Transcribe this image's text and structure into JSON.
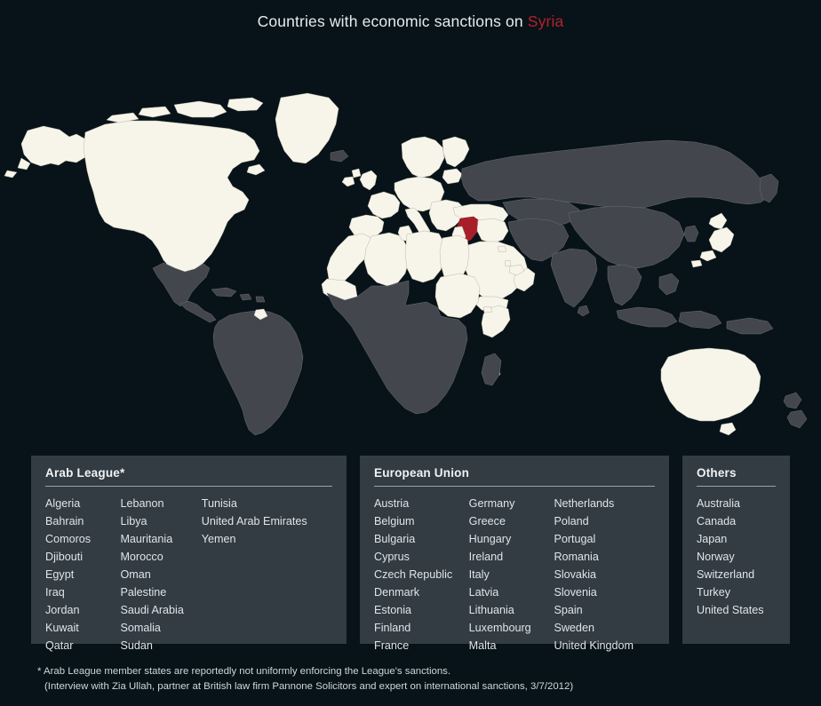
{
  "title": {
    "prefix": "Countries with economic sanctions on ",
    "subject": "Syria"
  },
  "colors": {
    "background": "#071318",
    "panel_background": "#333b43",
    "highlight_country": "#f7f5e9",
    "unhighlighted_country": "#43464c",
    "subject_country": "#a81f2a",
    "title_accent": "#b5202c",
    "text": "#dfe5e8"
  },
  "map": {
    "name": "world-map",
    "legend": {
      "highlighted_meaning": "Country imposing economic sanctions on Syria",
      "subject_meaning": "Syria"
    }
  },
  "panels": [
    {
      "id": "arab-league",
      "heading": "Arab League*",
      "columns": [
        [
          "Algeria",
          "Bahrain",
          "Comoros",
          "Djibouti",
          "Egypt",
          "Iraq",
          "Jordan",
          "Kuwait",
          "Qatar"
        ],
        [
          "Lebanon",
          "Libya",
          "Mauritania",
          "Morocco",
          "Oman",
          "Palestine",
          "Saudi Arabia",
          "Somalia",
          "Sudan"
        ],
        [
          "Tunisia",
          "United Arab Emirates",
          "Yemen"
        ]
      ]
    },
    {
      "id": "european-union",
      "heading": "European Union",
      "columns": [
        [
          "Austria",
          "Belgium",
          "Bulgaria",
          "Cyprus",
          "Czech Republic",
          "Denmark",
          "Estonia",
          "Finland",
          "France"
        ],
        [
          "Germany",
          "Greece",
          "Hungary",
          "Ireland",
          "Italy",
          "Latvia",
          "Lithuania",
          "Luxembourg",
          "Malta"
        ],
        [
          "Netherlands",
          "Poland",
          "Portugal",
          "Romania",
          "Slovakia",
          "Slovenia",
          "Spain",
          "Sweden",
          "United Kingdom"
        ]
      ]
    },
    {
      "id": "others",
      "heading": "Others",
      "columns": [
        [
          "Australia",
          "Canada",
          "Japan",
          "Norway",
          "Switzerland",
          "Turkey",
          "United States"
        ]
      ]
    }
  ],
  "footnote": {
    "line1": "* Arab League member states are reportedly not uniformly enforcing the League's sanctions.",
    "line2": "(Interview with Zia Ullah, partner at British law firm Pannone Solicitors and expert on international sanctions, 3/7/2012)"
  }
}
